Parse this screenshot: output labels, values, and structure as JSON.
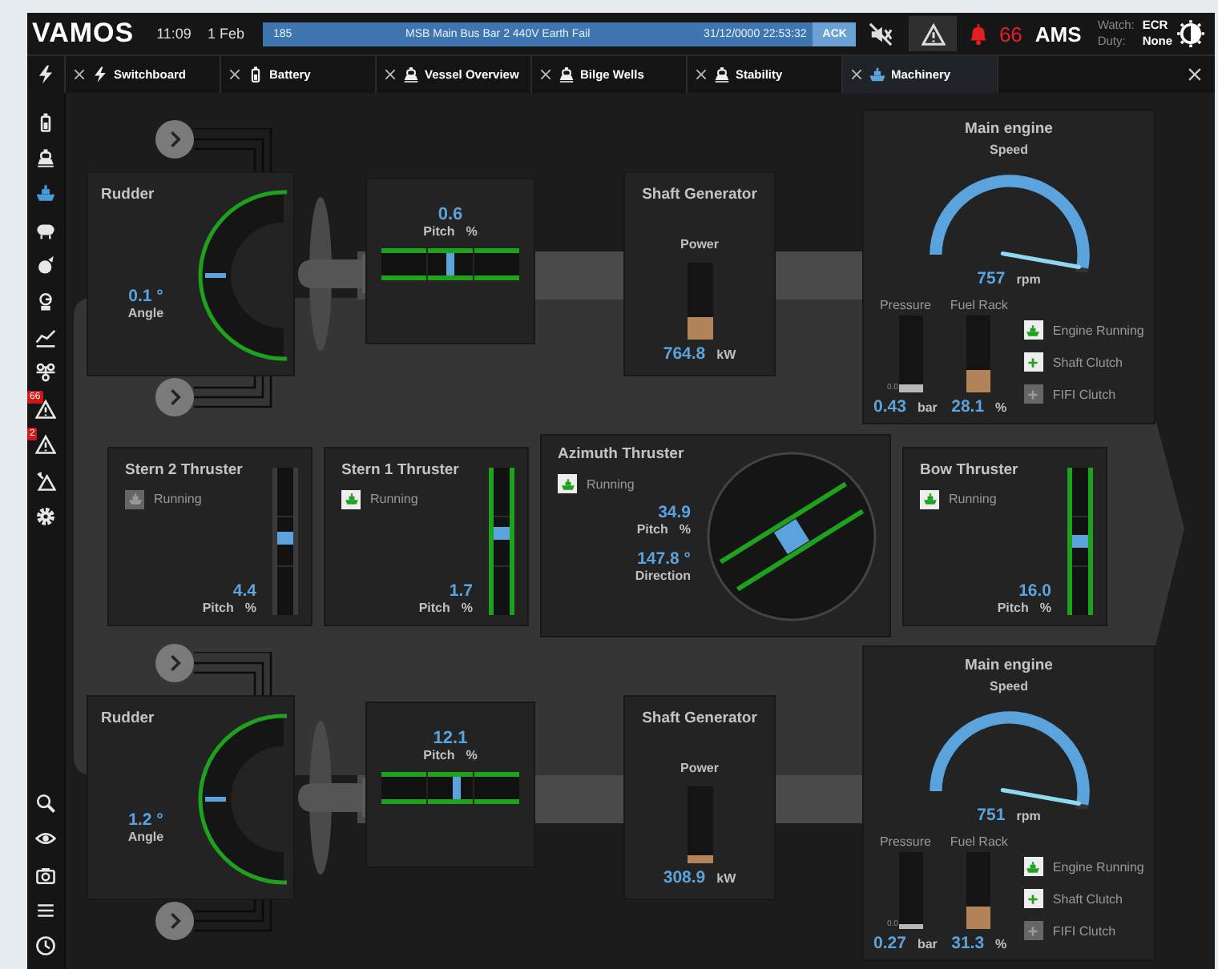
{
  "top_bar": {
    "logo": "VAMOS",
    "time": "11:09",
    "date": "1 Feb",
    "alarm": {
      "number": "185",
      "message": "MSB Main Bus Bar 2 440V Earth Fail",
      "timestamp": "31/12/0000 22:53:32",
      "ack": "ACK"
    },
    "alarm_count": "66",
    "ams": "AMS",
    "watch_label": "Watch:",
    "watch": "ECR",
    "duty_label": "Duty:",
    "duty": "None"
  },
  "tabs": [
    {
      "kind": "switch",
      "label": "Switchboard",
      "selected": false
    },
    {
      "kind": "battery",
      "label": "Battery",
      "selected": false
    },
    {
      "kind": "vessel",
      "label": "Vessel Overview",
      "selected": false
    },
    {
      "kind": "vessel",
      "label": "Bilge Wells",
      "selected": false
    },
    {
      "kind": "vessel",
      "label": "Stability",
      "selected": false
    },
    {
      "kind": "ship",
      "label": "Machinery",
      "selected": true
    }
  ],
  "sidebar": {
    "items": [
      {
        "kind": "battery",
        "selected": false
      },
      {
        "kind": "vessel",
        "selected": false
      },
      {
        "kind": "ship",
        "selected": true
      },
      {
        "kind": "tank",
        "selected": false
      },
      {
        "kind": "fire",
        "selected": false
      },
      {
        "kind": "pump",
        "selected": false
      },
      {
        "kind": "trend",
        "selected": false
      },
      {
        "kind": "network",
        "selected": false
      },
      {
        "kind": "alarm",
        "selected": false,
        "badge": "66"
      },
      {
        "kind": "alarm",
        "selected": false,
        "badge": "2"
      },
      {
        "kind": "alarm-split",
        "selected": false
      },
      {
        "kind": "settings",
        "selected": false
      }
    ],
    "tools": [
      {
        "kind": "zoom"
      },
      {
        "kind": "eye"
      },
      {
        "kind": "camera"
      },
      {
        "kind": "menu"
      },
      {
        "kind": "clock"
      }
    ]
  },
  "units": [
    {
      "rudder": {
        "title": "Rudder",
        "value": "0.1 °",
        "label": "Angle"
      },
      "pitch": {
        "value": "0.6",
        "label": "Pitch",
        "unit": "%",
        "level": 0.5
      },
      "shaft_generator": {
        "title": "Shaft Generator",
        "label": "Power",
        "value": "764.8",
        "unit": "kW",
        "level": 0.3
      },
      "main_engine": {
        "title": "Main engine",
        "subtitle": "Speed",
        "value": "757",
        "unit": "rpm",
        "pressure": {
          "label": "Pressure",
          "scale_min": "0.0",
          "value": "0.43",
          "unit": "bar",
          "level": 0.1
        },
        "fuel_rack": {
          "label": "Fuel Rack",
          "value": "28.1",
          "unit": "%",
          "level": 0.3
        },
        "indicators": [
          {
            "kind": "engine",
            "label": "Engine Running",
            "on": true
          },
          {
            "kind": "clutch",
            "label": "Shaft Clutch",
            "on": true
          },
          {
            "kind": "clutch",
            "label": "FIFI Clutch",
            "on": false
          }
        ]
      }
    },
    {
      "rudder": {
        "title": "Rudder",
        "value": "1.2 °",
        "label": "Angle"
      },
      "pitch": {
        "value": "12.1",
        "label": "Pitch",
        "unit": "%",
        "level": 0.55
      },
      "shaft_generator": {
        "title": "Shaft Generator",
        "label": "Power",
        "value": "308.9",
        "unit": "kW",
        "level": 0.1
      },
      "main_engine": {
        "title": "Main engine",
        "subtitle": "Speed",
        "value": "751",
        "unit": "rpm",
        "pressure": {
          "label": "Pressure",
          "scale_min": "0.0",
          "value": "0.27",
          "unit": "bar",
          "level": 0.06
        },
        "fuel_rack": {
          "label": "Fuel Rack",
          "value": "31.3",
          "unit": "%",
          "level": 0.3
        },
        "indicators": [
          {
            "kind": "engine",
            "label": "Engine Running",
            "on": true
          },
          {
            "kind": "clutch",
            "label": "Shaft Clutch",
            "on": true
          },
          {
            "kind": "clutch",
            "label": "FIFI Clutch",
            "on": false
          }
        ]
      }
    }
  ],
  "thrusters": [
    {
      "kind": "tunnel",
      "title": "Stern 2 Thruster",
      "running_label": "Running",
      "running": false,
      "value": "4.4",
      "label": "Pitch",
      "unit": "%",
      "level": 0.52
    },
    {
      "kind": "tunnel",
      "title": "Stern 1 Thruster",
      "running_label": "Running",
      "running": true,
      "value": "1.7",
      "label": "Pitch",
      "unit": "%",
      "level": 0.55
    },
    {
      "kind": "azimuth",
      "title": "Azimuth Thruster",
      "running_label": "Running",
      "running": true,
      "value": "34.9",
      "label": "Pitch",
      "unit": "%",
      "direction": "147.8 °",
      "direction_label": "Direction"
    },
    {
      "kind": "tunnel",
      "title": "Bow Thruster",
      "running_label": "Running",
      "running": true,
      "value": "16.0",
      "label": "Pitch",
      "unit": "%",
      "level": 0.5
    }
  ]
}
